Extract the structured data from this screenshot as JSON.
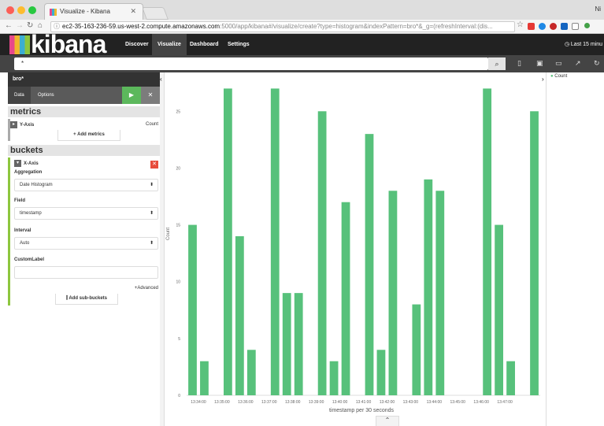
{
  "browser": {
    "tab_title": "Visualize - Kibana",
    "user_label": "Ni",
    "url_host": "ec2-35-163-236-59.us-west-2.compute.amazonaws.com",
    "url_rest": ":5000/app/kibana#/visualize/create?type=histogram&indexPattern=bro*&_g=(refreshInterval:(dis..."
  },
  "kibana": {
    "logo": "kibana",
    "nav": [
      "Discover",
      "Visualize",
      "Dashboard",
      "Settings"
    ],
    "time_picker": "Last 15 minu",
    "query": "*"
  },
  "sidebar": {
    "index_pattern": "bro*",
    "tabs": [
      "Data",
      "Options"
    ],
    "metrics_title": "metrics",
    "y_axis_label": "Y-Axis",
    "y_axis_value": "Count",
    "add_metrics": "Add metrics",
    "buckets_title": "buckets",
    "x_axis_label": "X-Axis",
    "aggregation_label": "Aggregation",
    "aggregation_value": "Date Histogram",
    "field_label": "Field",
    "field_value": "timestamp",
    "interval_label": "Interval",
    "interval_value": "Auto",
    "custom_label": "CustomLabel",
    "custom_label_value": "",
    "advanced_link": "Advanced",
    "add_sub_buckets": "Add sub-buckets"
  },
  "colors": {
    "bar": "#57c17b",
    "accent": "#8dc63f"
  },
  "chart_data": {
    "type": "bar",
    "title": "",
    "xlabel": "timestamp per 30 seconds",
    "ylabel": "Count",
    "ylim": [
      0,
      28
    ],
    "yticks": [
      0,
      5,
      10,
      15,
      20,
      25
    ],
    "legend": [
      "Count"
    ],
    "legend_position": "top-right",
    "xticks": [
      "13:34:00",
      "13:35:00",
      "13:36:00",
      "13:37:00",
      "13:38:00",
      "13:39:00",
      "13:40:00",
      "13:41:00",
      "13:42:00",
      "13:43:00",
      "13:44:00",
      "13:45:00",
      "13:46:00",
      "13:47:00"
    ],
    "series": [
      {
        "name": "Count",
        "values": [
          15,
          3,
          0,
          27,
          14,
          4,
          0,
          27,
          9,
          9,
          0,
          25,
          3,
          17,
          0,
          23,
          4,
          18,
          0,
          8,
          19,
          18,
          0,
          0,
          0,
          27,
          15,
          3,
          0,
          25
        ]
      }
    ]
  }
}
